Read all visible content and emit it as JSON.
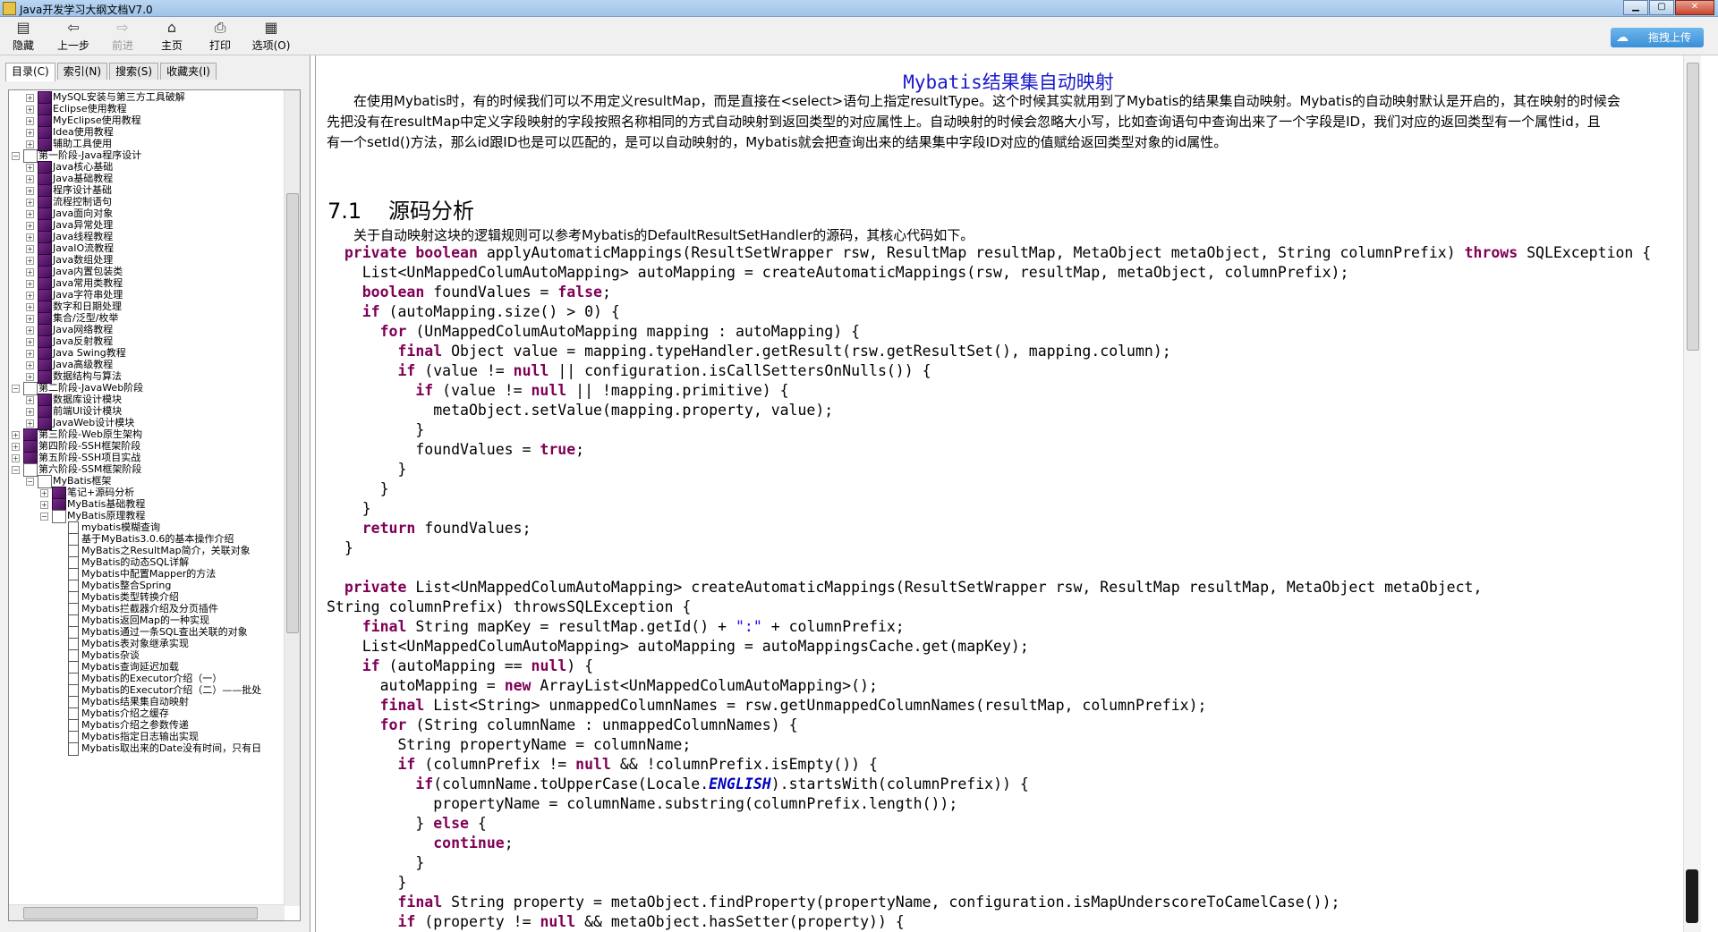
{
  "window": {
    "title": "Java开发学习大纲文档V7.0"
  },
  "toolbar": {
    "buttons": [
      {
        "label": "隐藏",
        "icon": "hide-icon"
      },
      {
        "label": "上一步",
        "icon": "back-arrow-icon"
      },
      {
        "label": "前进",
        "icon": "forward-arrow-icon"
      },
      {
        "label": "主页",
        "icon": "home-icon"
      },
      {
        "label": "打印",
        "icon": "printer-icon"
      },
      {
        "label": "选项(O)",
        "icon": "options-icon"
      }
    ],
    "upload_label": "拖拽上传"
  },
  "tabs": [
    "目录(C)",
    "索引(N)",
    "搜索(S)",
    "收藏夹(I)"
  ],
  "tree": [
    {
      "level": 2,
      "type": "book",
      "label": "MySQL安装与第三方工具破解"
    },
    {
      "level": 2,
      "type": "book",
      "label": "Eclipse使用教程"
    },
    {
      "level": 2,
      "type": "book",
      "label": "MyEclipse使用教程"
    },
    {
      "level": 2,
      "type": "book",
      "label": "Idea使用教程"
    },
    {
      "level": 2,
      "type": "book",
      "label": "辅助工具使用"
    },
    {
      "level": 1,
      "type": "open",
      "label": "第一阶段-Java程序设计"
    },
    {
      "level": 2,
      "type": "book",
      "label": "Java核心基础"
    },
    {
      "level": 2,
      "type": "book",
      "label": "Java基础教程"
    },
    {
      "level": 2,
      "type": "book",
      "label": "程序设计基础"
    },
    {
      "level": 2,
      "type": "book",
      "label": "流程控制语句"
    },
    {
      "level": 2,
      "type": "book",
      "label": "Java面向对象"
    },
    {
      "level": 2,
      "type": "book",
      "label": "Java异常处理"
    },
    {
      "level": 2,
      "type": "book",
      "label": "Java线程教程"
    },
    {
      "level": 2,
      "type": "book",
      "label": "JavaIO流教程"
    },
    {
      "level": 2,
      "type": "book",
      "label": "Java数组处理"
    },
    {
      "level": 2,
      "type": "book",
      "label": "Java内置包装类"
    },
    {
      "level": 2,
      "type": "book",
      "label": "Java常用类教程"
    },
    {
      "level": 2,
      "type": "book",
      "label": "Java字符串处理"
    },
    {
      "level": 2,
      "type": "book",
      "label": "数字和日期处理"
    },
    {
      "level": 2,
      "type": "book",
      "label": "集合/泛型/枚举"
    },
    {
      "level": 2,
      "type": "book",
      "label": "Java网络教程"
    },
    {
      "level": 2,
      "type": "book",
      "label": "Java反射教程"
    },
    {
      "level": 2,
      "type": "book",
      "label": "Java Swing教程"
    },
    {
      "level": 2,
      "type": "book",
      "label": "Java高级教程"
    },
    {
      "level": 2,
      "type": "book",
      "label": "数据结构与算法"
    },
    {
      "level": 1,
      "type": "open",
      "label": "第二阶段-JavaWeb阶段"
    },
    {
      "level": 2,
      "type": "book",
      "label": "数据库设计模块"
    },
    {
      "level": 2,
      "type": "book",
      "label": "前端UI设计模块"
    },
    {
      "level": 2,
      "type": "book",
      "label": "JavaWeb设计模块"
    },
    {
      "level": 1,
      "type": "book",
      "label": "第三阶段-Web原生架构"
    },
    {
      "level": 1,
      "type": "book",
      "label": "第四阶段-SSH框架阶段"
    },
    {
      "level": 1,
      "type": "book",
      "label": "第五阶段-SSH项目实战"
    },
    {
      "level": 1,
      "type": "open",
      "label": "第六阶段-SSM框架阶段"
    },
    {
      "level": 2,
      "type": "open",
      "label": "MyBatis框架"
    },
    {
      "level": 3,
      "type": "book",
      "label": "笔记+源码分析"
    },
    {
      "level": 3,
      "type": "book",
      "label": "MyBatis基础教程"
    },
    {
      "level": 3,
      "type": "open",
      "label": "MyBatis原理教程"
    },
    {
      "level": 4,
      "type": "page",
      "label": "mybatis模糊查询"
    },
    {
      "level": 4,
      "type": "page",
      "label": "基于MyBatis3.0.6的基本操作介绍"
    },
    {
      "level": 4,
      "type": "page",
      "label": "MyBatis之ResultMap简介，关联对象"
    },
    {
      "level": 4,
      "type": "page",
      "label": "MyBatis的动态SQL详解"
    },
    {
      "level": 4,
      "type": "page",
      "label": "Mybatis中配置Mapper的方法"
    },
    {
      "level": 4,
      "type": "page",
      "label": "Mybatis整合Spring"
    },
    {
      "level": 4,
      "type": "page",
      "label": "Mybatis类型转换介绍"
    },
    {
      "level": 4,
      "type": "page",
      "label": "Mybatis拦截器介绍及分页插件"
    },
    {
      "level": 4,
      "type": "page",
      "label": "Mybatis返回Map的一种实现"
    },
    {
      "level": 4,
      "type": "page",
      "label": "Mybatis通过一条SQL查出关联的对象"
    },
    {
      "level": 4,
      "type": "page",
      "label": "Mybatis表对象继承实现"
    },
    {
      "level": 4,
      "type": "page",
      "label": "Mybatis杂谈"
    },
    {
      "level": 4,
      "type": "page",
      "label": "Mybatis查询延迟加载"
    },
    {
      "level": 4,
      "type": "page",
      "label": "Mybatis的Executor介绍（一）"
    },
    {
      "level": 4,
      "type": "page",
      "label": "Mybatis的Executor介绍（二）——批处"
    },
    {
      "level": 4,
      "type": "page",
      "label": "Mybatis结果集自动映射"
    },
    {
      "level": 4,
      "type": "page",
      "label": "Mybatis介绍之缓存"
    },
    {
      "level": 4,
      "type": "page",
      "label": "Mybatis介绍之参数传递"
    },
    {
      "level": 4,
      "type": "page",
      "label": "Mybatis指定日志输出实现"
    },
    {
      "level": 4,
      "type": "page",
      "label": "Mybatis取出来的Date没有时间，只有日"
    }
  ],
  "document": {
    "title": "Mybatis结果集自动映射",
    "intro_lines": [
      "在使用Mybatis时，有的时候我们可以不用定义resultMap，而是直接在<select>语句上指定resultType。这个时候其实就用到了Mybatis的结果集自动映射。Mybatis的自动映射默认是开启的，其在映射的时候会",
      "先把没有在resultMap中定义字段映射的字段按照名称相同的方式自动映射到返回类型的对应属性上。自动映射的时候会忽略大小写，比如查询语句中查询出来了一个字段是ID，我们对应的返回类型有一个属性id，且",
      "有一个setId()方法，那么id跟ID也是可以匹配的，是可以自动映射的，Mybatis就会把查询出来的结果集中字段ID对应的值赋给返回类型对象的id属性。"
    ],
    "section_num": "7.1",
    "section_title": "源码分析",
    "section_intro": "关于自动映射这块的逻辑规则可以参考Mybatis的DefaultResultSetHandler的源码，其核心代码如下。",
    "code_lines": [
      "  private boolean applyAutomaticMappings(ResultSetWrapper rsw, ResultMap resultMap, MetaObject metaObject, String columnPrefix) throws SQLException {",
      "    List<UnMappedColumAutoMapping> autoMapping = createAutomaticMappings(rsw, resultMap, metaObject, columnPrefix);",
      "    boolean foundValues = false;",
      "    if (autoMapping.size() > 0) {",
      "      for (UnMappedColumAutoMapping mapping : autoMapping) {",
      "        final Object value = mapping.typeHandler.getResult(rsw.getResultSet(), mapping.column);",
      "        if (value != null || configuration.isCallSettersOnNulls()) {",
      "          if (value != null || !mapping.primitive) {",
      "            metaObject.setValue(mapping.property, value);",
      "          }",
      "          foundValues = true;",
      "        }",
      "      }",
      "    }",
      "    return foundValues;",
      "  }",
      "",
      "  private List<UnMappedColumAutoMapping> createAutomaticMappings(ResultSetWrapper rsw, ResultMap resultMap, MetaObject metaObject,",
      "String columnPrefix) throwsSQLException {",
      "    final String mapKey = resultMap.getId() + \":\" + columnPrefix;",
      "    List<UnMappedColumAutoMapping> autoMapping = autoMappingsCache.get(mapKey);",
      "    if (autoMapping == null) {",
      "      autoMapping = new ArrayList<UnMappedColumAutoMapping>();",
      "      final List<String> unmappedColumnNames = rsw.getUnmappedColumnNames(resultMap, columnPrefix);",
      "      for (String columnName : unmappedColumnNames) {",
      "        String propertyName = columnName;",
      "        if (columnPrefix != null && !columnPrefix.isEmpty()) {",
      "          if(columnName.toUpperCase(Locale.ENGLISH).startsWith(columnPrefix)) {",
      "            propertyName = columnName.substring(columnPrefix.length());",
      "          } else {",
      "            continue;",
      "          }",
      "        }",
      "        final String property = metaObject.findProperty(propertyName, configuration.isMapUnderscoreToCamelCase());",
      "        if (property != null && metaObject.hasSetter(property)) {"
    ]
  }
}
